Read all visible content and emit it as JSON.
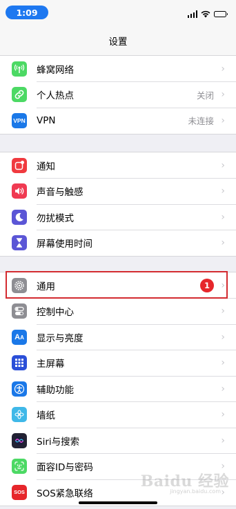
{
  "status_bar": {
    "time": "1:09"
  },
  "nav": {
    "title": "设置"
  },
  "group1": [
    {
      "label": "蜂窝网络",
      "value": "",
      "icon": "antenna-icon",
      "color": "#4cd964"
    },
    {
      "label": "个人热点",
      "value": "关闭",
      "icon": "link-icon",
      "color": "#4cd964"
    },
    {
      "label": "VPN",
      "value": "未连接",
      "icon": "vpn-icon",
      "color": "#1a78e8"
    }
  ],
  "group2": [
    {
      "label": "通知",
      "value": "",
      "icon": "notifications-icon",
      "color": "#f03a3f"
    },
    {
      "label": "声音与触感",
      "value": "",
      "icon": "speaker-icon",
      "color": "#f03a52"
    },
    {
      "label": "勿扰模式",
      "value": "",
      "icon": "moon-icon",
      "color": "#5b56d6"
    },
    {
      "label": "屏幕使用时间",
      "value": "",
      "icon": "hourglass-icon",
      "color": "#5b56d6"
    }
  ],
  "group3": [
    {
      "label": "通用",
      "badge": "1",
      "icon": "gear-icon",
      "color": "#8e8e93"
    },
    {
      "label": "控制中心",
      "icon": "toggles-icon",
      "color": "#8e8e93"
    },
    {
      "label": "显示与亮度",
      "icon": "text-size-icon",
      "color": "#1a78e8"
    },
    {
      "label": "主屏幕",
      "icon": "home-grid-icon",
      "color": "#2b4fd8"
    },
    {
      "label": "辅助功能",
      "icon": "accessibility-icon",
      "color": "#1a78e8"
    },
    {
      "label": "墙纸",
      "icon": "flower-icon",
      "color": "#3fb8e8"
    },
    {
      "label": "Siri与搜索",
      "icon": "siri-icon",
      "color": "#222233"
    },
    {
      "label": "面容ID与密码",
      "icon": "face-id-icon",
      "color": "#4cd964"
    },
    {
      "label": "SOS紧急联络",
      "icon": "sos-icon",
      "color": "#e6262b",
      "icon_text": "SOS"
    }
  ],
  "watermark": {
    "main": "Baidu 经验",
    "sub": "jingyan.baidu.com"
  }
}
